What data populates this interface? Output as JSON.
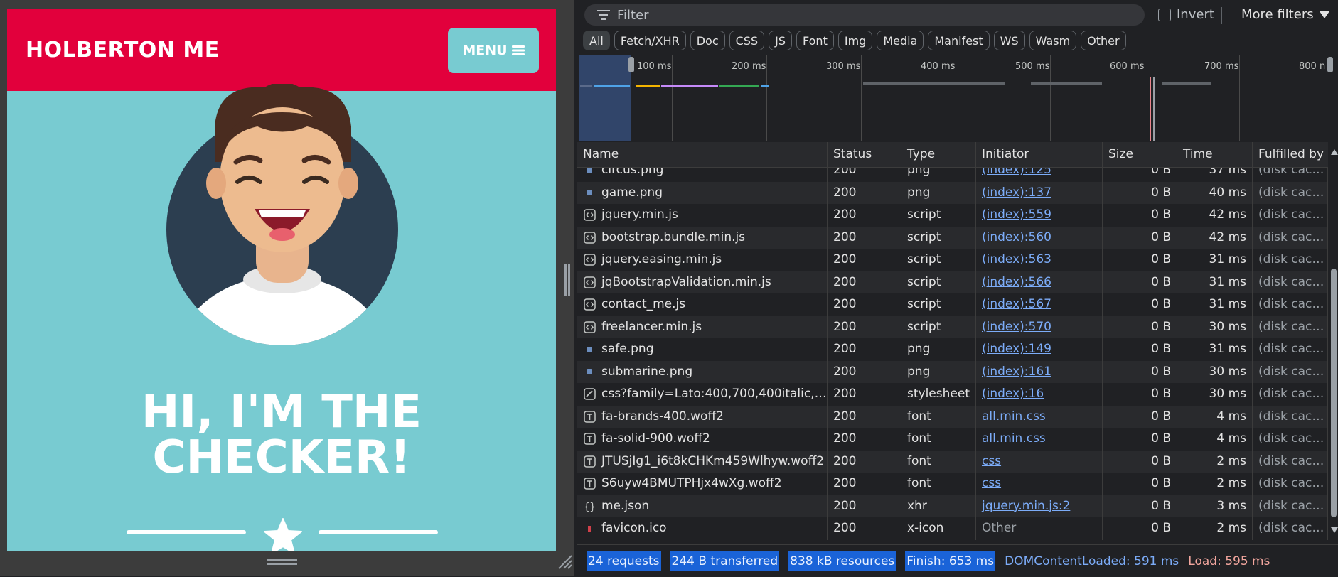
{
  "preview": {
    "brand": "HOLBERTON ME",
    "menu_label": "MENU",
    "hero_line1": "HI, I'M THE",
    "hero_line2": "CHECKER!"
  },
  "filterbar": {
    "filter_placeholder": "Filter",
    "invert_label": "Invert",
    "more_filters_label": "More filters"
  },
  "type_filters": [
    "All",
    "Fetch/XHR",
    "Doc",
    "CSS",
    "JS",
    "Font",
    "Img",
    "Media",
    "Manifest",
    "WS",
    "Wasm",
    "Other"
  ],
  "overview": {
    "ticks": [
      "100 ms",
      "200 ms",
      "300 ms",
      "400 ms",
      "500 ms",
      "600 ms",
      "700 ms",
      "800 n"
    ]
  },
  "columns": [
    "Name",
    "Status",
    "Type",
    "Initiator",
    "Size",
    "Time",
    "Fulfilled by"
  ],
  "requests": [
    {
      "name": "circus.png",
      "status": "200",
      "type": "png",
      "initiator": "(index):125",
      "size": "0 B",
      "time": "37 ms",
      "fulfilled": "(disk cache)",
      "icon": "image-icon"
    },
    {
      "name": "game.png",
      "status": "200",
      "type": "png",
      "initiator": "(index):137",
      "size": "0 B",
      "time": "40 ms",
      "fulfilled": "(disk cache)",
      "icon": "image-icon"
    },
    {
      "name": "jquery.min.js",
      "status": "200",
      "type": "script",
      "initiator": "(index):559",
      "size": "0 B",
      "time": "42 ms",
      "fulfilled": "(disk cache)",
      "icon": "script-icon"
    },
    {
      "name": "bootstrap.bundle.min.js",
      "status": "200",
      "type": "script",
      "initiator": "(index):560",
      "size": "0 B",
      "time": "42 ms",
      "fulfilled": "(disk cache)",
      "icon": "script-icon"
    },
    {
      "name": "jquery.easing.min.js",
      "status": "200",
      "type": "script",
      "initiator": "(index):563",
      "size": "0 B",
      "time": "31 ms",
      "fulfilled": "(disk cache)",
      "icon": "script-icon"
    },
    {
      "name": "jqBootstrapValidation.min.js",
      "status": "200",
      "type": "script",
      "initiator": "(index):566",
      "size": "0 B",
      "time": "31 ms",
      "fulfilled": "(disk cache)",
      "icon": "script-icon"
    },
    {
      "name": "contact_me.js",
      "status": "200",
      "type": "script",
      "initiator": "(index):567",
      "size": "0 B",
      "time": "31 ms",
      "fulfilled": "(disk cache)",
      "icon": "script-icon"
    },
    {
      "name": "freelancer.min.js",
      "status": "200",
      "type": "script",
      "initiator": "(index):570",
      "size": "0 B",
      "time": "30 ms",
      "fulfilled": "(disk cache)",
      "icon": "script-icon"
    },
    {
      "name": "safe.png",
      "status": "200",
      "type": "png",
      "initiator": "(index):149",
      "size": "0 B",
      "time": "31 ms",
      "fulfilled": "(disk cache)",
      "icon": "image-icon"
    },
    {
      "name": "submarine.png",
      "status": "200",
      "type": "png",
      "initiator": "(index):161",
      "size": "0 B",
      "time": "30 ms",
      "fulfilled": "(disk cache)",
      "icon": "image-icon"
    },
    {
      "name": "css?family=Lato:400,700,400italic,700...",
      "status": "200",
      "type": "stylesheet",
      "initiator": "(index):16",
      "size": "0 B",
      "time": "30 ms",
      "fulfilled": "(disk cache)",
      "icon": "stylesheet-icon"
    },
    {
      "name": "fa-brands-400.woff2",
      "status": "200",
      "type": "font",
      "initiator": "all.min.css",
      "size": "0 B",
      "time": "4 ms",
      "fulfilled": "(disk cache)",
      "icon": "font-icon"
    },
    {
      "name": "fa-solid-900.woff2",
      "status": "200",
      "type": "font",
      "initiator": "all.min.css",
      "size": "0 B",
      "time": "4 ms",
      "fulfilled": "(disk cache)",
      "icon": "font-icon"
    },
    {
      "name": "JTUSjIg1_i6t8kCHKm459Wlhyw.woff2",
      "status": "200",
      "type": "font",
      "initiator": "css",
      "size": "0 B",
      "time": "2 ms",
      "fulfilled": "(disk cache)",
      "icon": "font-icon"
    },
    {
      "name": "S6uyw4BMUTPHjx4wXg.woff2",
      "status": "200",
      "type": "font",
      "initiator": "css",
      "size": "0 B",
      "time": "2 ms",
      "fulfilled": "(disk cache)",
      "icon": "font-icon"
    },
    {
      "name": "me.json",
      "status": "200",
      "type": "xhr",
      "initiator": "jquery.min.js:2",
      "size": "0 B",
      "time": "3 ms",
      "fulfilled": "(disk cache)",
      "icon": "json-icon"
    },
    {
      "name": "favicon.ico",
      "status": "200",
      "type": "x-icon",
      "initiator": "Other",
      "size": "0 B",
      "time": "2 ms",
      "fulfilled": "(disk cache)",
      "icon": "favicon-icon"
    }
  ],
  "statusbar": {
    "requests": "24 requests",
    "transferred": "244 B transferred",
    "resources": "838 kB resources",
    "finish": "Finish: 653 ms",
    "dom_content_loaded": "DOMContentLoaded: 591 ms",
    "load": "Load: 595 ms"
  },
  "colors": {
    "navbar": "#e2003c",
    "hero_bg": "#78cbd1",
    "link": "#7cacf8",
    "highlight": "#1a63d8"
  }
}
